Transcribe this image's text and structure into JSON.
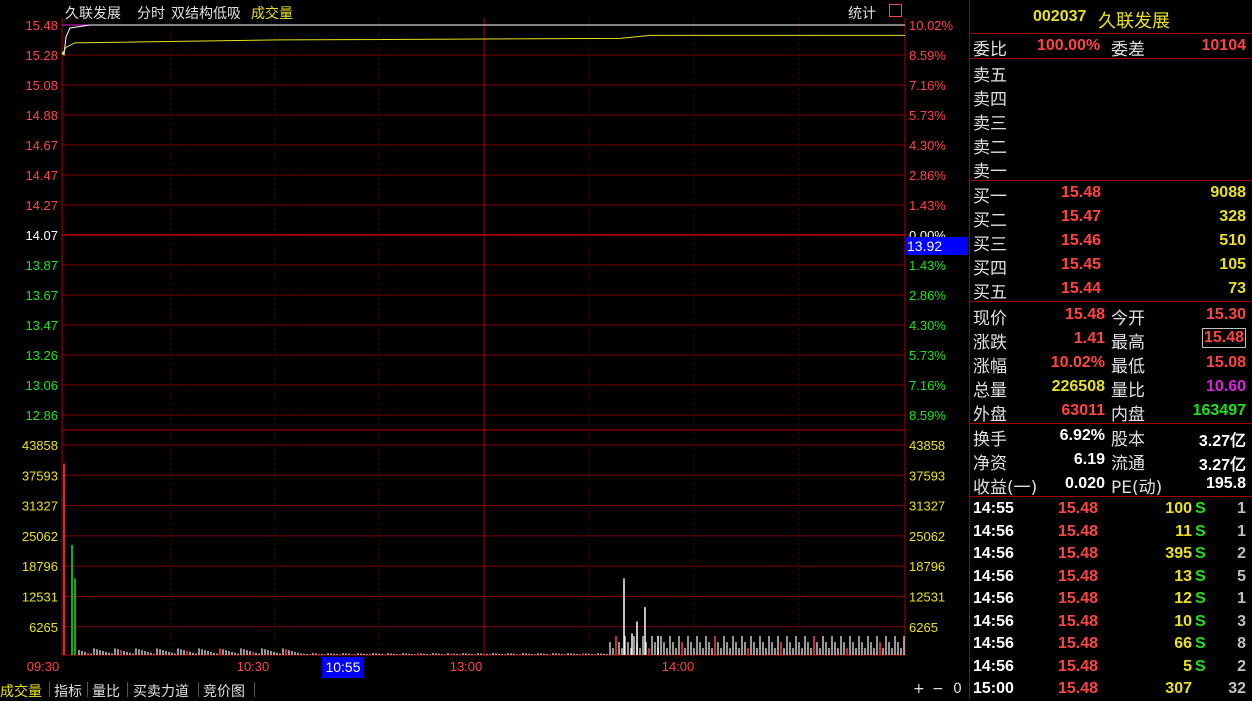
{
  "header": {
    "stock_name": "久联发展",
    "tab_fenshi": "分时",
    "indicator": "双结构低吸",
    "volume_label": "成交量",
    "stats_label": "统计"
  },
  "price_axis": {
    "left_labels": [
      "15.48",
      "15.28",
      "15.08",
      "14.88",
      "14.67",
      "14.47",
      "14.27",
      "14.07",
      "13.87",
      "13.67",
      "13.47",
      "13.26",
      "13.06",
      "12.86"
    ],
    "right_labels": [
      "10.02%",
      "8.59%",
      "7.16%",
      "5.73%",
      "4.30%",
      "2.86%",
      "1.43%",
      "0.00%",
      "1.43%",
      "2.86%",
      "4.30%",
      "5.73%",
      "7.16%",
      "8.59%"
    ],
    "cursor_price": "13.92"
  },
  "volume_axis": {
    "labels": [
      "43858",
      "37593",
      "31327",
      "25062",
      "18796",
      "12531",
      "6265"
    ]
  },
  "time_axis": {
    "labels": [
      "09:30",
      "10:30",
      "13:00",
      "14:00"
    ],
    "cursor_time": "10:55"
  },
  "bottom_tabs": [
    "成交量",
    "指标",
    "量比",
    "买卖力道",
    "竞价图"
  ],
  "zoom": {
    "plus": "+",
    "minus": "−",
    "zero": "0"
  },
  "chart_data": {
    "type": "line",
    "price_series": {
      "name": "",
      "open": 15.3,
      "close": 15.48,
      "high": 15.48,
      "low": 15.08
    },
    "volume_bars": [
      {
        "t": "09:30",
        "v": 40000,
        "color": "red"
      },
      {
        "t": "09:34",
        "v": 23000,
        "color": "green"
      },
      {
        "t": "09:35",
        "v": 16000,
        "color": "green"
      },
      {
        "t": "13:47",
        "v": 16000,
        "color": "white"
      },
      {
        "t": "13:57",
        "v": 10000,
        "color": "white"
      }
    ],
    "ylim": [
      12.86,
      15.48
    ],
    "vol_ylim": [
      0,
      43858
    ]
  },
  "panel": {
    "title_code": "002037",
    "title_name": "久联发展",
    "weibi_label": "委比",
    "weibi": "100.00%",
    "weicha_label": "委差",
    "weicha": "10104",
    "sell": [
      {
        "label": "卖五"
      },
      {
        "label": "卖四"
      },
      {
        "label": "卖三"
      },
      {
        "label": "卖二"
      },
      {
        "label": "卖一"
      }
    ],
    "buy": [
      {
        "label": "买一",
        "price": "15.48",
        "vol": "9088"
      },
      {
        "label": "买二",
        "price": "15.47",
        "vol": "328"
      },
      {
        "label": "买三",
        "price": "15.46",
        "vol": "510"
      },
      {
        "label": "买四",
        "price": "15.45",
        "vol": "105"
      },
      {
        "label": "买五",
        "price": "15.44",
        "vol": "73"
      }
    ],
    "quote": [
      {
        "l1": "现价",
        "v1": "15.48",
        "l2": "今开",
        "v2": "15.30"
      },
      {
        "l1": "涨跌",
        "v1": "1.41",
        "l2": "最高",
        "v2": "15.48"
      },
      {
        "l1": "涨幅",
        "v1": "10.02%",
        "l2": "最低",
        "v2": "15.08"
      },
      {
        "l1": "总量",
        "v1": "226508",
        "l2": "量比",
        "v2": "10.60"
      },
      {
        "l1": "外盘",
        "v1": "63011",
        "l2": "内盘",
        "v2": "163497"
      }
    ],
    "fin": [
      {
        "l1": "换手",
        "v1": "6.92%",
        "l2": "股本",
        "v2": "3.27亿"
      },
      {
        "l1": "净资",
        "v1": "6.19",
        "l2": "流通",
        "v2": "3.27亿"
      },
      {
        "l1": "收益(一)",
        "v1": "0.020",
        "l2": "PE(动)",
        "v2": "195.8"
      }
    ],
    "ticks": [
      {
        "time": "14:55",
        "price": "15.48",
        "vol": "100",
        "flag": "S",
        "n": "1"
      },
      {
        "time": "14:56",
        "price": "15.48",
        "vol": "11",
        "flag": "S",
        "n": "1"
      },
      {
        "time": "14:56",
        "price": "15.48",
        "vol": "395",
        "flag": "S",
        "n": "2"
      },
      {
        "time": "14:56",
        "price": "15.48",
        "vol": "13",
        "flag": "S",
        "n": "5"
      },
      {
        "time": "14:56",
        "price": "15.48",
        "vol": "12",
        "flag": "S",
        "n": "1"
      },
      {
        "time": "14:56",
        "price": "15.48",
        "vol": "10",
        "flag": "S",
        "n": "3"
      },
      {
        "time": "14:56",
        "price": "15.48",
        "vol": "66",
        "flag": "S",
        "n": "8"
      },
      {
        "time": "14:56",
        "price": "15.48",
        "vol": "5",
        "flag": "S",
        "n": "2"
      },
      {
        "time": "15:00",
        "price": "15.48",
        "vol": "307",
        "flag": "",
        "n": "32"
      }
    ]
  },
  "colors": {
    "grid": "#7a0000",
    "up": "#ff4444",
    "down": "#20e020",
    "avg": "#e8e020",
    "price_line": "#ffffff",
    "cursor_box": "#0000ff"
  }
}
